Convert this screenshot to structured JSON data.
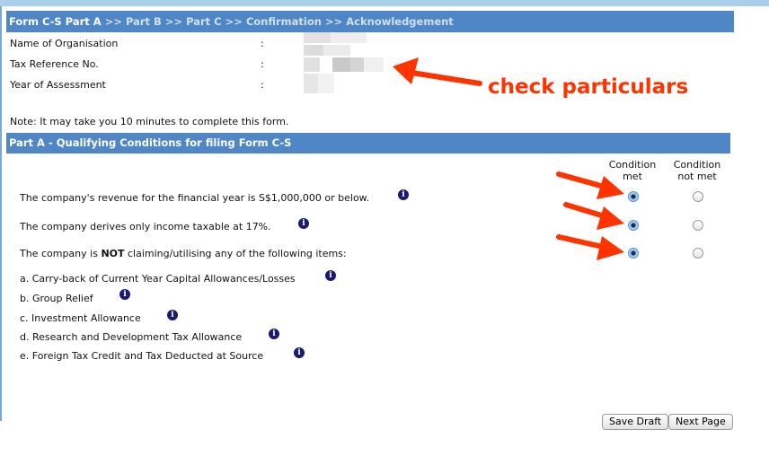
{
  "breadcrumb": {
    "current": "Form C-S Part A",
    "separator": ">>",
    "steps": [
      "Part B",
      "Part C",
      "Confirmation",
      "Acknowledgement"
    ]
  },
  "particulars": [
    {
      "label": "Name of Organisation",
      "colon": ":"
    },
    {
      "label": "Tax Reference No.",
      "colon": ":"
    },
    {
      "label": "Year of Assessment",
      "colon": ":"
    }
  ],
  "annotation": {
    "text": "check particulars",
    "color": "#ff3300"
  },
  "note": "Note: It may take you 10 minutes to complete this form.",
  "section_title": "Part A - Qualifying Conditions for filing Form C-S",
  "columns": {
    "met": [
      "Condition",
      "met"
    ],
    "not_met": [
      "Condition",
      "not met"
    ]
  },
  "conditions": [
    {
      "pre": "The company's revenue for the financial year is S$1,000,000 or below.",
      "bold": "",
      "post": "",
      "selected": "met"
    },
    {
      "pre": "The company derives only income taxable at 17%.",
      "bold": "",
      "post": "",
      "selected": "met"
    },
    {
      "pre": "The company is ",
      "bold": "NOT",
      "post": " claiming/utilising any of the following items:",
      "selected": "met"
    }
  ],
  "items": [
    "a. Carry-back of Current Year Capital Allowances/Losses",
    "b. Group Relief",
    "c. Investment Allowance",
    "d. Research and Development Tax Allowance",
    "e. Foreign Tax Credit and Tax Deducted at Source"
  ],
  "info_icon_glyph": "i",
  "buttons": {
    "save_draft": "Save Draft",
    "next_page": "Next Page"
  },
  "colors": {
    "header_bar": "#4f86c6",
    "annotation": "#ff3300"
  }
}
